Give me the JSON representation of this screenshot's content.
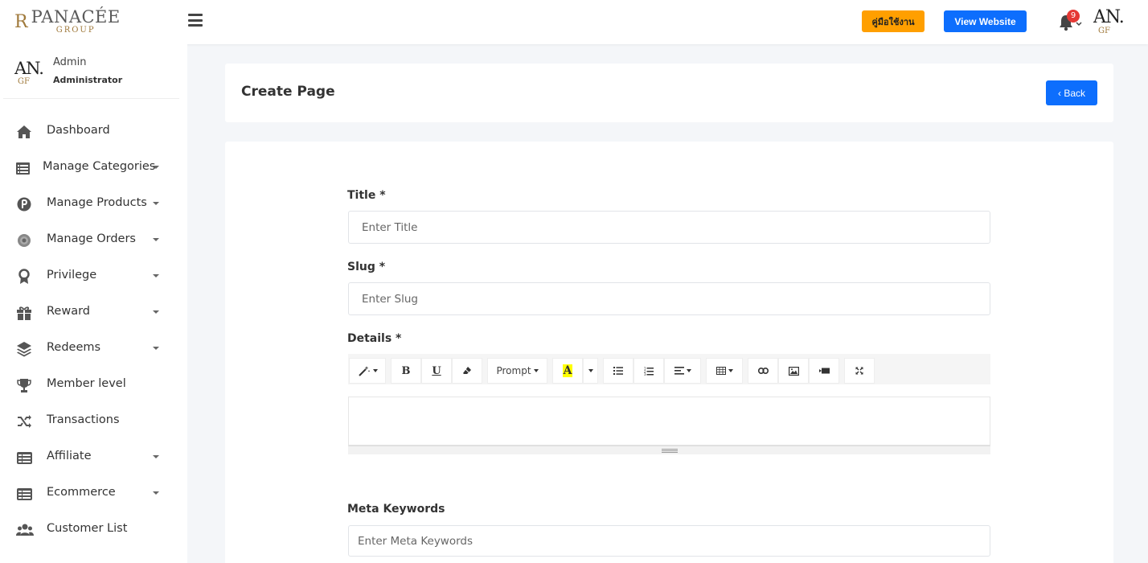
{
  "header": {
    "logo_mark": "R",
    "logo_line1": "PANACÉE",
    "logo_line2": "GROUP",
    "manual_button": "คู่มือใช้งาน",
    "view_website_button": "View Website",
    "notification_count": "9",
    "avatar_text1": "AN.",
    "avatar_text2": "GF"
  },
  "sidebar": {
    "user": {
      "avatar_text1": "AN.",
      "avatar_text2": "GF",
      "name": "Admin",
      "role": "Administrator"
    },
    "items": [
      {
        "label": "Dashboard",
        "icon": "home-icon"
      },
      {
        "label": "Manage Categories",
        "icon": "list-icon"
      },
      {
        "label": "Manage Products",
        "icon": "product-icon"
      },
      {
        "label": "Manage Orders",
        "icon": "orders-icon"
      },
      {
        "label": "Privilege",
        "icon": "award-icon"
      },
      {
        "label": "Reward",
        "icon": "gift-icon"
      },
      {
        "label": "Redeems",
        "icon": "layers-icon"
      },
      {
        "label": "Member level",
        "icon": "trophy-icon"
      },
      {
        "label": "Transactions",
        "icon": "shuffle-icon"
      },
      {
        "label": "Affiliate",
        "icon": "table-icon"
      },
      {
        "label": "Ecommerce",
        "icon": "table-icon"
      },
      {
        "label": "Customer List",
        "icon": "users-icon"
      }
    ]
  },
  "page": {
    "title": "Create Page",
    "back_button": "Back"
  },
  "form": {
    "title_label": "Title *",
    "title_placeholder": "Enter Title",
    "slug_label": "Slug *",
    "slug_placeholder": "Enter Slug",
    "details_label": "Details *",
    "font_dropdown": "Prompt",
    "meta_keywords_label": "Meta Keywords",
    "meta_keywords_placeholder": "Enter Meta Keywords"
  },
  "colors": {
    "primary": "#0d6efd",
    "warning": "#ff9f00",
    "badge": "#e53935"
  }
}
